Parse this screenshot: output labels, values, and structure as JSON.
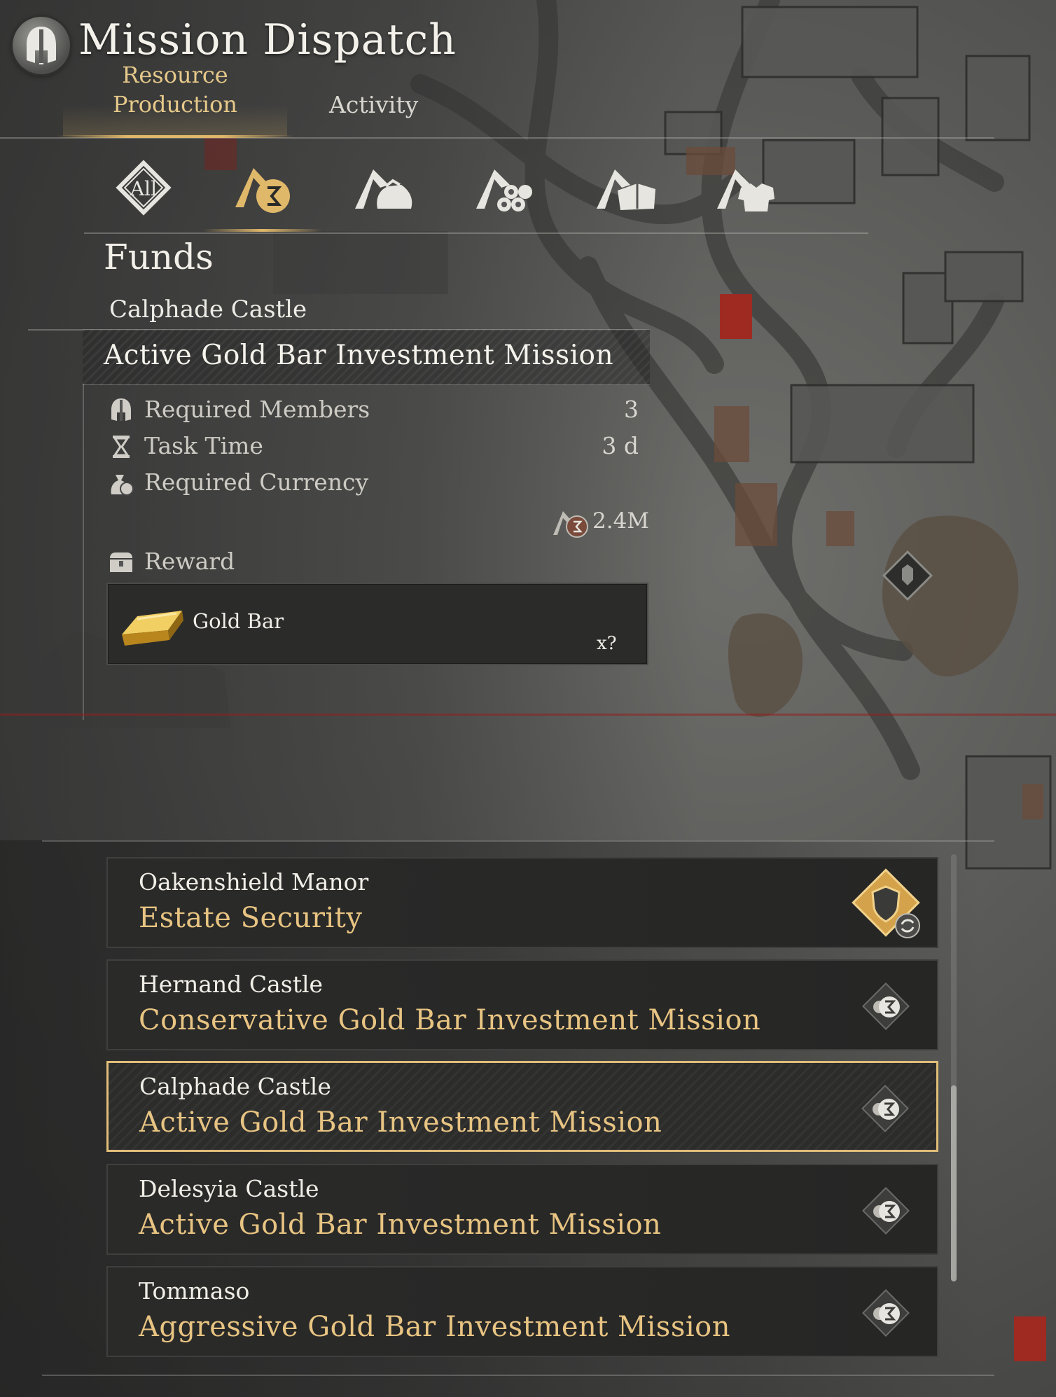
{
  "header": {
    "title": "Mission Dispatch",
    "tabs": [
      {
        "label_line1": "Resource",
        "label_line2": "Production",
        "active": true
      },
      {
        "label": "Activity",
        "active": false
      }
    ]
  },
  "categories": [
    {
      "name": "all",
      "label": "All",
      "active": false
    },
    {
      "name": "funds",
      "active": true
    },
    {
      "name": "food",
      "active": false
    },
    {
      "name": "wood",
      "active": false
    },
    {
      "name": "stone",
      "active": false
    },
    {
      "name": "iron",
      "active": false
    }
  ],
  "detail": {
    "category_title": "Funds",
    "location": "Calphade Castle",
    "mission_name": "Active Gold Bar Investment Mission",
    "rows": {
      "members_label": "Required Members",
      "members_value": "3",
      "time_label": "Task Time",
      "time_value": "3 d",
      "currency_label": "Required Currency",
      "currency_value": "2.4M"
    },
    "reward_label": "Reward",
    "reward": {
      "name": "Gold Bar",
      "qty": "x?"
    }
  },
  "missions": [
    {
      "location": "Oakenshield Manor",
      "name": "Estate Security",
      "icon": "shield-refresh-icon",
      "selected": false
    },
    {
      "location": "Hernand Castle",
      "name": "Conservative Gold Bar Investment Mission",
      "icon": "funds-icon",
      "selected": false
    },
    {
      "location": "Calphade Castle",
      "name": "Active Gold Bar Investment Mission",
      "icon": "funds-icon",
      "selected": true
    },
    {
      "location": "Delesyia Castle",
      "name": "Active Gold Bar Investment Mission",
      "icon": "funds-icon",
      "selected": false
    },
    {
      "location": "Tommaso",
      "name": "Aggressive Gold Bar Investment Mission",
      "icon": "funds-icon",
      "selected": false
    }
  ],
  "colors": {
    "accent_gold": "#e0bd78",
    "mission_text": "#e8c482",
    "card_bg": "#2a2a29"
  }
}
